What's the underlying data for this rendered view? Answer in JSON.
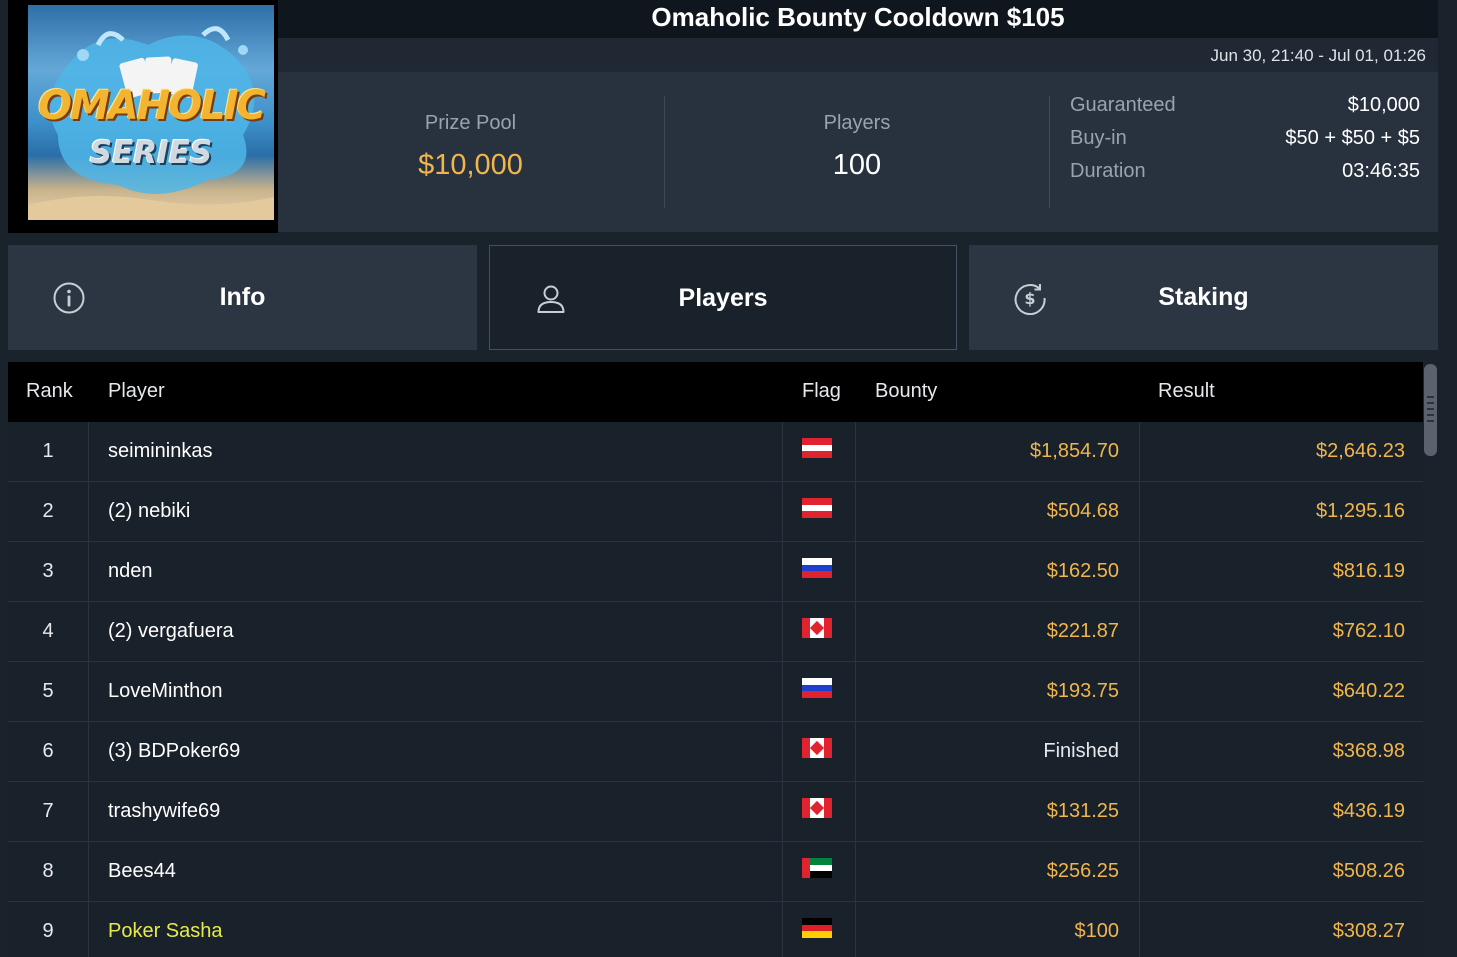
{
  "tournament": {
    "title": "Omaholic Bounty Cooldown $105",
    "dates": "Jun 30, 21:40 - Jul 01, 01:26",
    "logo": {
      "line1": "OMAHOLIC",
      "line2": "SERIES"
    }
  },
  "stats": {
    "prize_pool_label": "Prize Pool",
    "prize_pool_value": "$10,000",
    "players_label": "Players",
    "players_value": "100",
    "details": [
      {
        "label": "Guaranteed",
        "value": "$10,000"
      },
      {
        "label": "Buy-in",
        "value": "$50 + $50 + $5"
      },
      {
        "label": "Duration",
        "value": "03:46:35"
      }
    ]
  },
  "tabs": [
    {
      "label": "Info",
      "icon": "info-icon",
      "active": false
    },
    {
      "label": "Players",
      "icon": "user-icon",
      "active": true
    },
    {
      "label": "Staking",
      "icon": "dollar-coin-icon",
      "active": false
    }
  ],
  "table": {
    "headers": {
      "rank": "Rank",
      "player": "Player",
      "flag": "Flag",
      "bounty": "Bounty",
      "result": "Result"
    },
    "rows": [
      {
        "rank": "1",
        "player": "seimininkas",
        "flag": "austria",
        "bounty": "$1,854.70",
        "result": "$2,646.23",
        "highlight": false
      },
      {
        "rank": "2",
        "player": "(2) nebiki",
        "flag": "austria",
        "bounty": "$504.68",
        "result": "$1,295.16",
        "highlight": false
      },
      {
        "rank": "3",
        "player": "nden",
        "flag": "russia",
        "bounty": "$162.50",
        "result": "$816.19",
        "highlight": false
      },
      {
        "rank": "4",
        "player": "(2) vergafuera",
        "flag": "canada",
        "bounty": "$221.87",
        "result": "$762.10",
        "highlight": false
      },
      {
        "rank": "5",
        "player": "LoveMinthon",
        "flag": "russia",
        "bounty": "$193.75",
        "result": "$640.22",
        "highlight": false
      },
      {
        "rank": "6",
        "player": "(3) BDPoker69",
        "flag": "canada",
        "bounty": "Finished",
        "result": "$368.98",
        "highlight": false
      },
      {
        "rank": "7",
        "player": "trashywife69",
        "flag": "canada",
        "bounty": "$131.25",
        "result": "$436.19",
        "highlight": false
      },
      {
        "rank": "8",
        "player": "Bees44",
        "flag": "uae",
        "bounty": "$256.25",
        "result": "$508.26",
        "highlight": false
      },
      {
        "rank": "9",
        "player": "Poker Sasha",
        "flag": "germany",
        "bounty": "$100",
        "result": "$308.27",
        "highlight": true
      }
    ]
  },
  "colors": {
    "accent_gold": "#f0b54c",
    "highlight_player": "#e7ea4e",
    "background": "#1a222c",
    "header_black": "#000000"
  }
}
